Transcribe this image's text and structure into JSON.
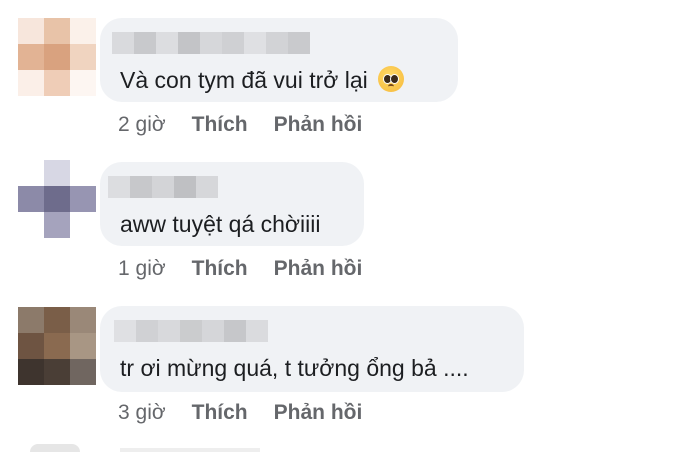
{
  "comments": [
    {
      "text": "Và con tym đã vui trở lại",
      "emoji_icon": "pleading-face-emoji",
      "time": "2 giờ",
      "like_label": "Thích",
      "reply_label": "Phản hồi"
    },
    {
      "text": "aww tuyệt qá chờiiii",
      "time": "1 giờ",
      "like_label": "Thích",
      "reply_label": "Phản hồi"
    },
    {
      "text": "tr ơi mừng quá, t tưởng ổng bả ....",
      "time": "3 giờ",
      "like_label": "Thích",
      "reply_label": "Phản hồi"
    }
  ],
  "colors": {
    "bubble_bg": "#f0f2f5",
    "meta_text": "#65676b",
    "comment_text": "#1c1e21"
  }
}
